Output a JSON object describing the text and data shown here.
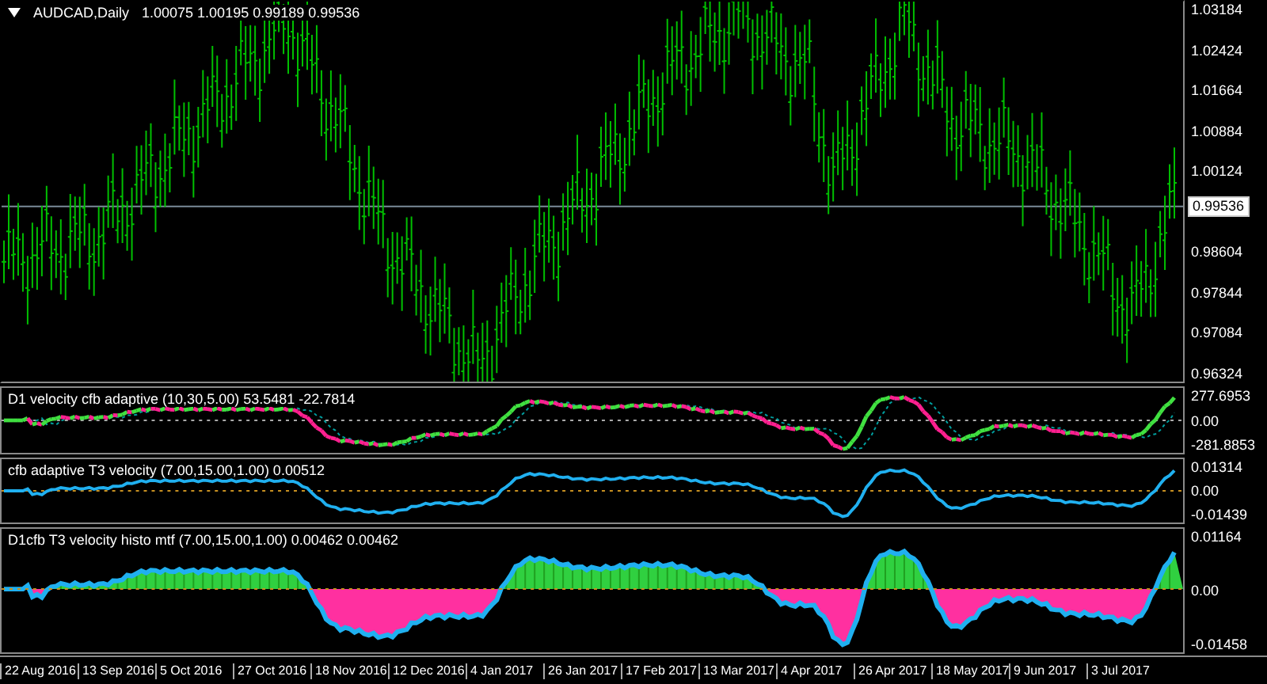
{
  "main_chart": {
    "symbol": "AUDCAD,Daily",
    "ohlc": "1.00075 1.00195 0.99189 0.99536",
    "price_axis": [
      "1.03184",
      "1.02424",
      "1.01664",
      "1.00884",
      "1.00124",
      "0.98604",
      "0.97844",
      "0.97084",
      "0.96324"
    ],
    "current_price": "0.99536"
  },
  "indicators": [
    {
      "kind": "colored-line",
      "title": "D1 velocity cfb adaptive (10,30,5.00) 53.5481 -22.7814",
      "axis": [
        "277.6953",
        "0.00",
        "-281.8853"
      ]
    },
    {
      "kind": "line",
      "title": "cfb adaptive T3 velocity (7.00,15.00,1.00) 0.00512",
      "axis": [
        "0.01314",
        "0.00",
        "-0.01439"
      ]
    },
    {
      "kind": "histogram",
      "title": "D1cfb T3 velocity histo mtf (7.00,15.00,1.00) 0.00462 0.00462",
      "axis": [
        "0.01164",
        "0.00",
        "-0.01458"
      ]
    }
  ],
  "time_axis": [
    "22 Aug 2016",
    "13 Sep 2016",
    "5 Oct 2016",
    "27 Oct 2016",
    "18 Nov 2016",
    "12 Dec 2016",
    "4 Jan 2017",
    "26 Jan 2017",
    "17 Feb 2017",
    "13 Mar 2017",
    "4 Apr 2017",
    "26 Apr 2017",
    "18 May 2017",
    "9 Jun 2017",
    "3 Jul 2017"
  ]
}
